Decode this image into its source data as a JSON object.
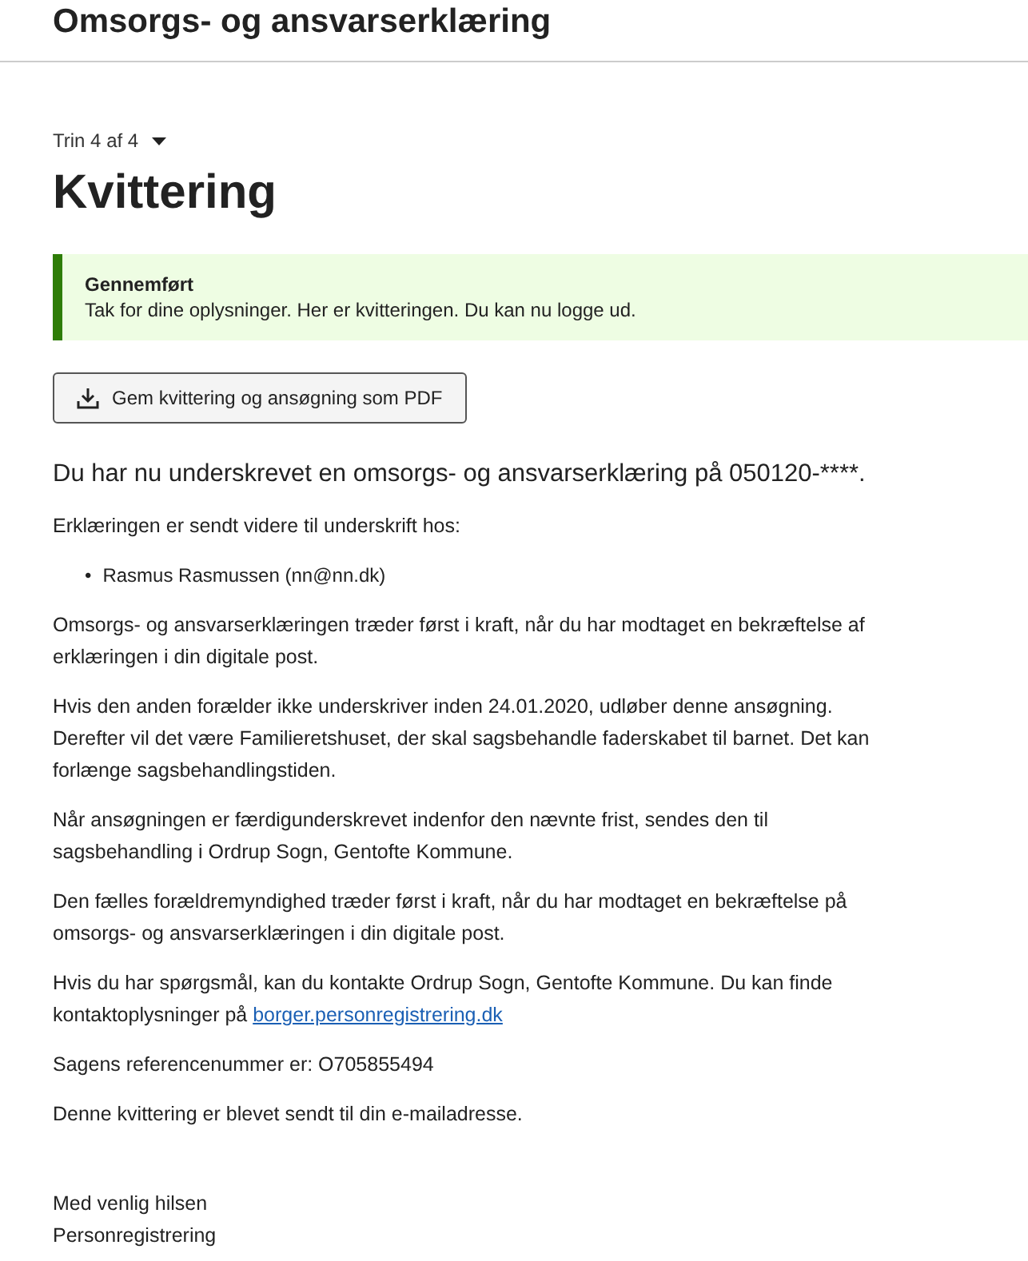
{
  "header": {
    "title": "Omsorgs- og ansvarserklæring"
  },
  "step": {
    "label": "Trin 4 af 4",
    "expanded": false
  },
  "page_title": "Kvittering",
  "alert": {
    "kind": "success",
    "title": "Gennemført",
    "message": "Tak for dine oplysninger. Her er kvitteringen. Du kan nu logge ud."
  },
  "download_button": "Gem kvittering og ansøgning som PDF",
  "lead": "Du har nu underskrevet en omsorgs- og ansvarserklæring på 050120-****.",
  "content": [
    {
      "kind": "text",
      "text": "Erklæringen er sendt videre til underskrift hos:"
    },
    {
      "kind": "list",
      "marker": "•",
      "items": [
        "Rasmus Rasmussen (nn@nn.dk)"
      ]
    },
    {
      "kind": "text",
      "text": "Omsorgs- og ansvarserklæringen træder først i kraft, når du har modtaget en bekræftelse af erklæringen i din digitale post."
    },
    {
      "kind": "text",
      "text": "Hvis den anden forælder ikke underskriver inden 24.01.2020, udløber denne ansøgning. Derefter vil det være Familieretshuset, der skal sagsbehandle faderskabet til barnet. Det kan forlænge sagsbehandlingstiden."
    },
    {
      "kind": "text",
      "text": "Når ansøgningen er færdigunderskrevet indenfor den nævnte frist, sendes den til sagsbehandling i Ordrup Sogn, Gentofte Kommune."
    },
    {
      "kind": "text",
      "text": "Den fælles forældremyndighed træder først i kraft, når du har modtaget en bekræftelse på omsorgs- og ansvarserklæringen i din digitale post."
    },
    {
      "kind": "link_text",
      "text": "Hvis du har spørgsmål, kan du kontakte Ordrup Sogn, Gentofte Kommune. Du kan finde kontaktoplysninger på",
      "link": "borger.personregistrering.dk"
    },
    {
      "kind": "text",
      "text": "Sagens referencenummer er: O705855494"
    },
    {
      "kind": "text",
      "text": "Denne kvittering er blevet sendt til din e-mailadresse."
    }
  ],
  "signature": [
    "Med venlig hilsen",
    "Personregistrering"
  ]
}
